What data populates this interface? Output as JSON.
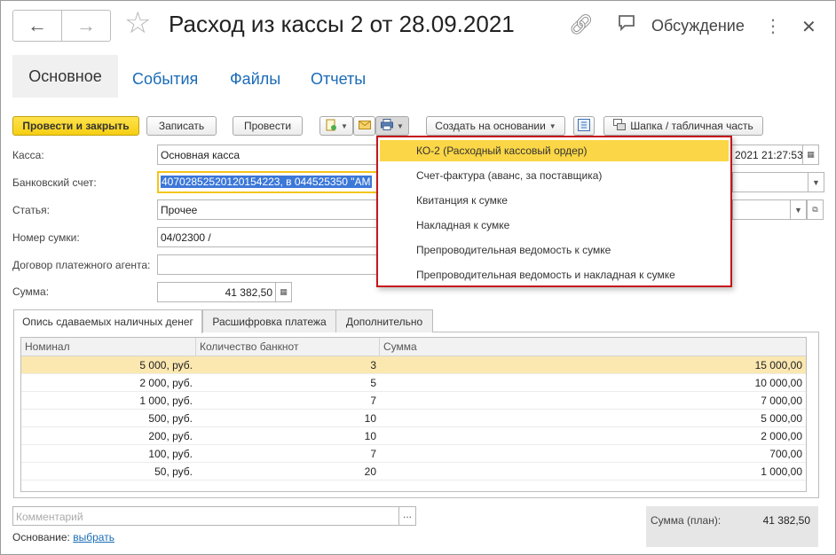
{
  "header": {
    "title": "Расход из кассы 2 от 28.09.2021",
    "discussion_label": "Обсуждение"
  },
  "form_tabs": [
    "Основное",
    "События",
    "Файлы",
    "Отчеты"
  ],
  "toolbar": {
    "post_and_close": "Провести и закрыть",
    "save": "Записать",
    "post": "Провести",
    "create_based_on": "Создать на основании",
    "header_table_part": "Шапка / табличная часть"
  },
  "fields": {
    "kassa": {
      "label": "Касса:",
      "value": "Основная касса"
    },
    "date_value": "2021 21:27:53",
    "bank_account": {
      "label": "Банковский счет:",
      "value": "40702852520120154223, в 044525350 \"АМ"
    },
    "article": {
      "label": "Статья:",
      "value": "Прочее"
    },
    "bag_number": {
      "label": "Номер сумки:",
      "value": "04/02300 /"
    },
    "agent_contract": {
      "label": "Договор платежного агента:",
      "value": ""
    },
    "amount": {
      "label": "Сумма:",
      "value": "41 382,50"
    }
  },
  "print_menu": {
    "items": [
      "КО-2 (Расходный кассовый ордер)",
      "Счет-фактура (аванс, за поставщика)",
      "Квитанция к сумке",
      "Накладная к сумке",
      "Препроводительная ведомость к сумке",
      "Препроводительная ведомость и накладная к сумке"
    ],
    "active_index": 0
  },
  "table_tabs": [
    "Опись сдаваемых наличных денег",
    "Расшифровка платежа",
    "Дополнительно"
  ],
  "table": {
    "columns": [
      "Номинал",
      "Количество банкнот",
      "Сумма"
    ],
    "rows": [
      [
        "5 000, руб.",
        "3",
        "15 000,00"
      ],
      [
        "2 000, руб.",
        "5",
        "10 000,00"
      ],
      [
        "1 000, руб.",
        "7",
        "7 000,00"
      ],
      [
        "500, руб.",
        "10",
        "5 000,00"
      ],
      [
        "200, руб.",
        "10",
        "2 000,00"
      ],
      [
        "100, руб.",
        "7",
        "700,00"
      ],
      [
        "50, руб.",
        "20",
        "1 000,00"
      ]
    ],
    "selected_row": 0
  },
  "footer": {
    "comment_placeholder": "Комментарий",
    "comment_button": "...",
    "basis_label": "Основание:",
    "basis_link": "выбрать",
    "total_label": "Сумма (план):",
    "total_value": "41 382,50"
  },
  "colors": {
    "accent_yellow": "#f6cf12",
    "link_blue": "#1a6bb7",
    "dropdown_border": "#c4161c",
    "highlight": "#fbd646"
  }
}
